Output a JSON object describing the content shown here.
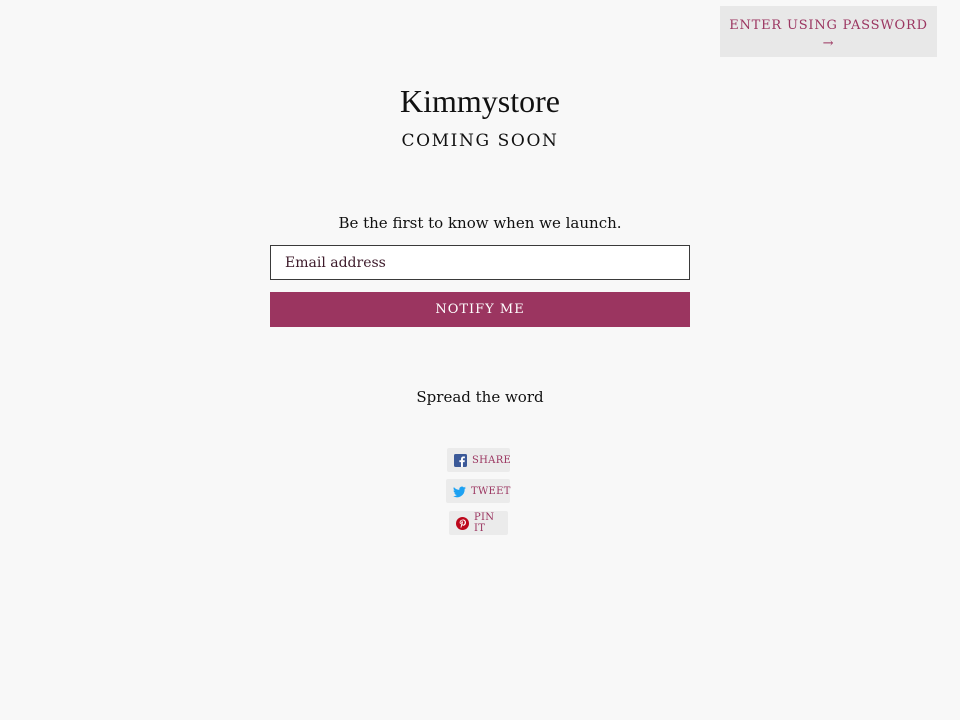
{
  "header": {
    "enter_password_label": "ENTER USING PASSWORD",
    "enter_password_arrow": "→"
  },
  "store": {
    "title": "Kimmystore",
    "subtitle": "COMING SOON"
  },
  "signup": {
    "prompt": "Be the first to know when we launch.",
    "email_placeholder": "Email address",
    "email_value": "",
    "submit_label": "NOTIFY ME"
  },
  "social": {
    "heading": "Spread the word",
    "buttons": [
      {
        "label": "SHARE",
        "icon": "facebook-icon"
      },
      {
        "label": "TWEET",
        "icon": "twitter-icon"
      },
      {
        "label": "PIN IT",
        "icon": "pinterest-icon"
      }
    ]
  },
  "colors": {
    "accent": "#9b3560",
    "background": "#f8f8f8",
    "facebook": "#3b5998",
    "twitter": "#1da1f2",
    "pinterest": "#bd081c"
  }
}
